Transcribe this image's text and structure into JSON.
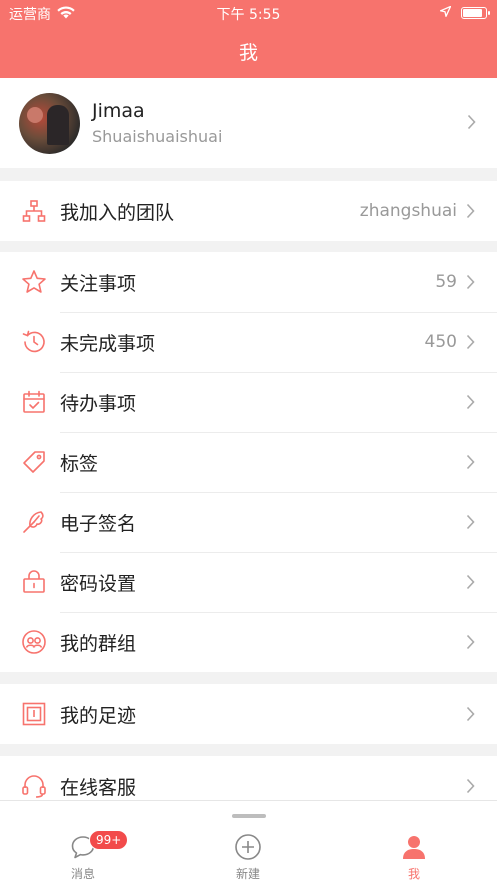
{
  "status_bar": {
    "carrier": "运营商",
    "time": "下午 5:55"
  },
  "nav": {
    "title": "我"
  },
  "profile": {
    "name": "Jimaa",
    "subtitle": "Shuaishuaishuai"
  },
  "team_row": {
    "label": "我加入的团队",
    "value": "zhangshuai",
    "icon": "team-icon"
  },
  "items_group": [
    {
      "label": "关注事项",
      "value": "59",
      "icon": "star-icon"
    },
    {
      "label": "未完成事项",
      "value": "450",
      "icon": "history-icon"
    },
    {
      "label": "待办事项",
      "value": "",
      "icon": "calendar-check-icon"
    },
    {
      "label": "标签",
      "value": "",
      "icon": "tag-icon"
    },
    {
      "label": "电子签名",
      "value": "",
      "icon": "signature-icon"
    },
    {
      "label": "密码设置",
      "value": "",
      "icon": "lock-icon"
    },
    {
      "label": "我的群组",
      "value": "",
      "icon": "group-icon"
    }
  ],
  "footprint_row": {
    "label": "我的足迹",
    "icon": "footprint-icon"
  },
  "service_row": {
    "label": "在线客服",
    "icon": "headset-icon"
  },
  "tabbar": {
    "tabs": [
      {
        "label": "消息",
        "icon": "message-icon",
        "badge": "99+"
      },
      {
        "label": "新建",
        "icon": "add-circle-icon"
      },
      {
        "label": "我",
        "icon": "person-icon"
      }
    ]
  },
  "colors": {
    "accent": "#f7736d",
    "badge": "#f24b4b"
  }
}
